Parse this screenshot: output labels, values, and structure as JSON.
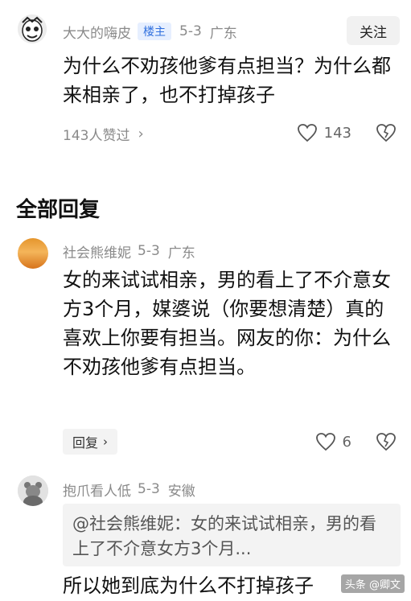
{
  "post": {
    "author": "大大的嗨皮",
    "badge": "楼主",
    "date": "5-3",
    "location": "广东",
    "follow_label": "关注",
    "text": "为什么不劝孩他爹有点担当？为什么都来相亲了，也不打掉孩子",
    "likes_summary": "143人赞过",
    "like_count": "143"
  },
  "section_title": "全部回复",
  "comments": [
    {
      "author": "社会熊维妮",
      "date": "5-3",
      "location": "广东",
      "text": "女的来试试相亲，男的看上了不介意女方3个月，媒婆说（你要想清楚）真的喜欢上你要有担当。网友的你：为什么不劝孩他爹有点担当。",
      "reply_label": "回复",
      "like_count": "6"
    },
    {
      "author": "抱爪看人低",
      "date": "5-3",
      "location": "安徽",
      "quote": "@社会熊维妮：女的来试试相亲，男的看上了不介意女方3个月...",
      "text": "所以她到底为什么不打掉孩子"
    }
  ],
  "watermark": "头条 @卿文",
  "icons": {
    "chevron": "chevron-right-icon",
    "like": "heart-icon",
    "dislike": "broken-heart-icon"
  }
}
